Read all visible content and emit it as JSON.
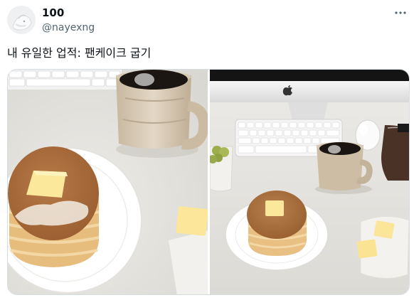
{
  "tweet": {
    "display_name": "100",
    "handle": "@nayexng",
    "text": "내 유일한 업적: 팬케이크 굽기"
  },
  "icons": {
    "avatar": "avatar-image",
    "more": "more-horizontal-icon"
  },
  "colors": {
    "handle_gray": "#536471",
    "text_dark": "#0f1419",
    "media_border": "#d6dde2"
  },
  "media": {
    "photos": [
      {
        "subject": "pancake-stack-closeup"
      },
      {
        "subject": "desk-with-pancakes-and-coffee"
      }
    ]
  }
}
